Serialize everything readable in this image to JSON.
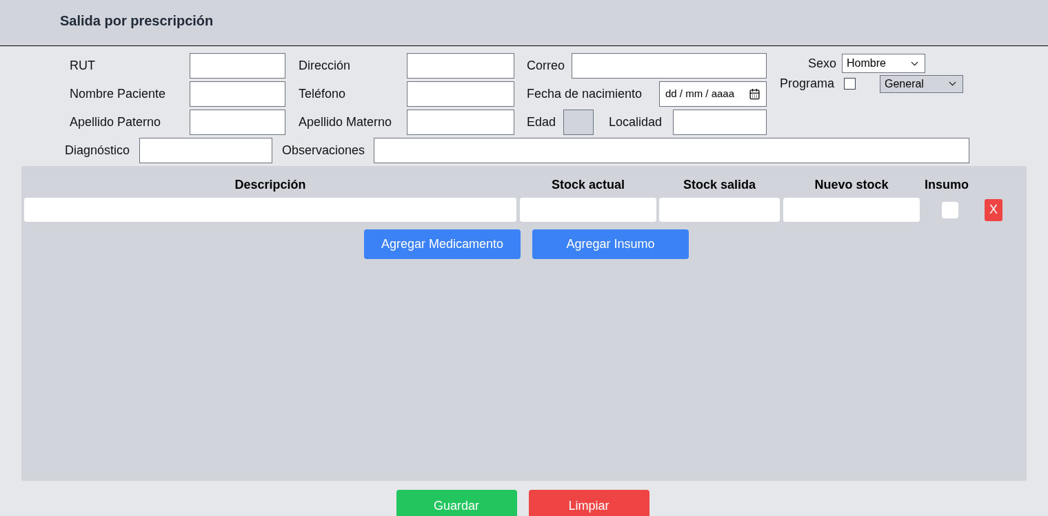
{
  "header": {
    "title": "Salida por prescripción"
  },
  "form": {
    "rows": [
      [
        {
          "label": "RUT",
          "kind": "text"
        },
        {
          "label": "Dirección",
          "kind": "text"
        },
        {
          "label": "Correo",
          "kind": "text"
        }
      ],
      [
        {
          "label": "Nombre Paciente",
          "kind": "text"
        },
        {
          "label": "Teléfono",
          "kind": "text"
        },
        {
          "label": "Fecha de nacimiento",
          "kind": "date",
          "placeholder": "dd / mm / aaaa"
        }
      ],
      [
        {
          "label": "Apellido Paterno",
          "kind": "text"
        },
        {
          "label": "Apellido Materno",
          "kind": "text"
        },
        {
          "label": "Edad",
          "kind": "readonly"
        },
        {
          "label": "Localidad",
          "kind": "text"
        }
      ],
      [
        {
          "label": "Diagnóstico",
          "kind": "text"
        },
        {
          "label": "Observaciones",
          "kind": "text"
        }
      ]
    ],
    "sexo": {
      "label": "Sexo",
      "value": "Hombre"
    },
    "programa": {
      "label": "Programa",
      "checked": false,
      "value": "General",
      "disabled": true
    }
  },
  "table": {
    "columns": [
      "Descripción",
      "Stock actual",
      "Stock salida",
      "Nuevo stock",
      "Insumo"
    ],
    "rows": [
      {
        "insumo": false,
        "remove": "X"
      }
    ],
    "buttons": [
      "Agregar Medicamento",
      "Agregar Insumo"
    ]
  },
  "footer": {
    "buttons": [
      {
        "label": "Guardar",
        "kind": "save"
      },
      {
        "label": "Limpiar",
        "kind": "clear"
      }
    ]
  }
}
